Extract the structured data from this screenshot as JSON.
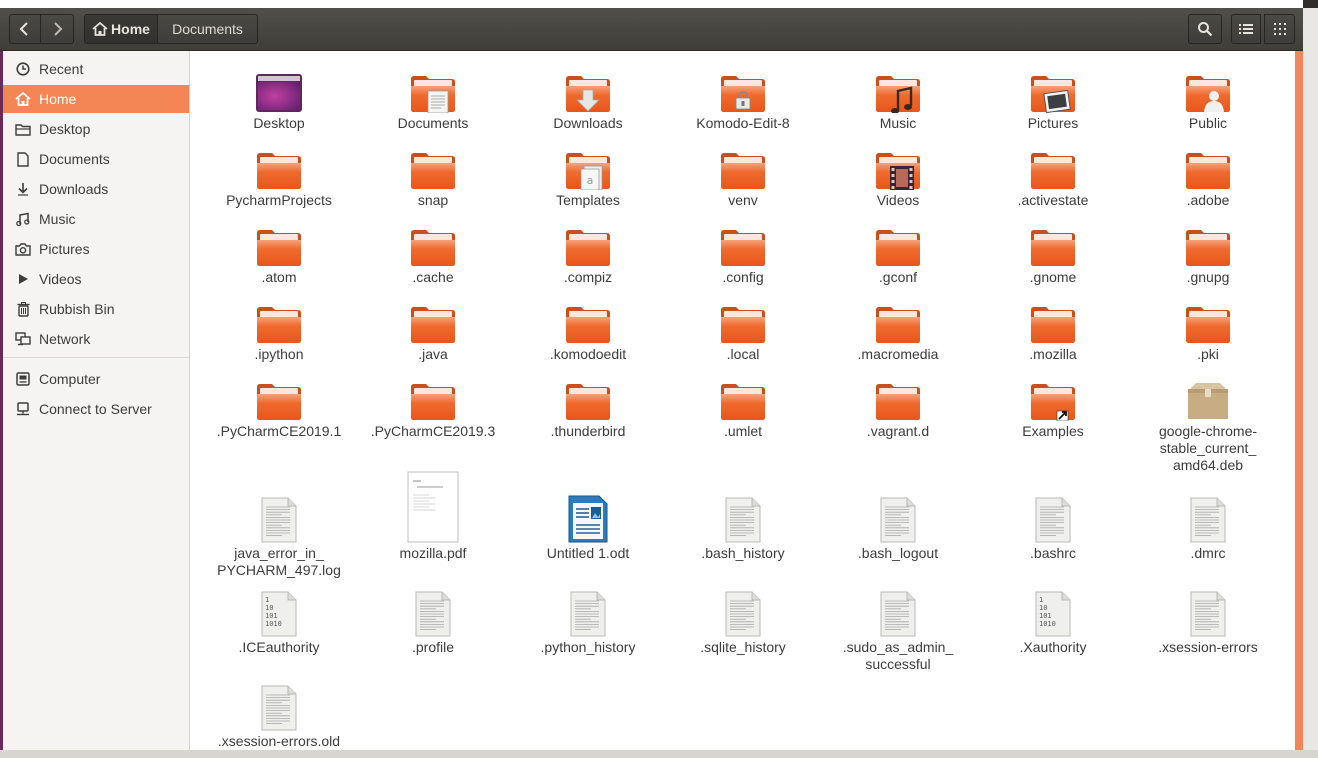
{
  "header": {
    "breadcrumb": {
      "home": "Home",
      "current": "Documents"
    }
  },
  "sidebar": {
    "items": [
      {
        "label": "Recent",
        "icon": "clock-icon"
      },
      {
        "label": "Home",
        "icon": "home-icon",
        "active": true
      },
      {
        "label": "Desktop",
        "icon": "folder-icon"
      },
      {
        "label": "Documents",
        "icon": "document-icon"
      },
      {
        "label": "Downloads",
        "icon": "download-icon"
      },
      {
        "label": "Music",
        "icon": "music-icon"
      },
      {
        "label": "Pictures",
        "icon": "camera-icon"
      },
      {
        "label": "Videos",
        "icon": "video-icon"
      },
      {
        "label": "Rubbish Bin",
        "icon": "trash-icon"
      },
      {
        "label": "Network",
        "icon": "network-icon"
      }
    ],
    "devices": [
      {
        "label": "Computer",
        "icon": "computer-icon"
      },
      {
        "label": "Connect to Server",
        "icon": "server-icon"
      }
    ]
  },
  "files": [
    {
      "name": "Desktop",
      "type": "desktop"
    },
    {
      "name": "Documents",
      "type": "folder-documents"
    },
    {
      "name": "Downloads",
      "type": "folder-downloads"
    },
    {
      "name": "Komodo-Edit-8",
      "type": "folder-locked"
    },
    {
      "name": "Music",
      "type": "folder-music"
    },
    {
      "name": "Pictures",
      "type": "folder-pictures"
    },
    {
      "name": "Public",
      "type": "folder-public"
    },
    {
      "name": "PycharmProjects",
      "type": "folder"
    },
    {
      "name": "snap",
      "type": "folder"
    },
    {
      "name": "Templates",
      "type": "folder-templates"
    },
    {
      "name": "venv",
      "type": "folder"
    },
    {
      "name": "Videos",
      "type": "folder-videos"
    },
    {
      "name": ".activestate",
      "type": "folder"
    },
    {
      "name": ".adobe",
      "type": "folder"
    },
    {
      "name": ".atom",
      "type": "folder"
    },
    {
      "name": ".cache",
      "type": "folder"
    },
    {
      "name": ".compiz",
      "type": "folder"
    },
    {
      "name": ".config",
      "type": "folder"
    },
    {
      "name": ".gconf",
      "type": "folder"
    },
    {
      "name": ".gnome",
      "type": "folder"
    },
    {
      "name": ".gnupg",
      "type": "folder"
    },
    {
      "name": ".ipython",
      "type": "folder"
    },
    {
      "name": ".java",
      "type": "folder"
    },
    {
      "name": ".komodoedit",
      "type": "folder"
    },
    {
      "name": ".local",
      "type": "folder"
    },
    {
      "name": ".macromedia",
      "type": "folder"
    },
    {
      "name": ".mozilla",
      "type": "folder"
    },
    {
      "name": ".pki",
      "type": "folder"
    },
    {
      "name": ".PyCharmCE2019.1",
      "type": "folder"
    },
    {
      "name": ".PyCharmCE2019.3",
      "type": "folder"
    },
    {
      "name": ".thunderbird",
      "type": "folder"
    },
    {
      "name": ".umlet",
      "type": "folder"
    },
    {
      "name": ".vagrant.d",
      "type": "folder"
    },
    {
      "name": "Examples",
      "type": "folder-link"
    },
    {
      "name": "google-chrome-stable_current_amd64.deb",
      "type": "package"
    },
    {
      "name": "java_error_in_PYCHARM_497.log",
      "type": "text"
    },
    {
      "name": "mozilla.pdf",
      "type": "pdf"
    },
    {
      "name": "Untitled 1.odt",
      "type": "odt"
    },
    {
      "name": ".bash_history",
      "type": "text"
    },
    {
      "name": ".bash_logout",
      "type": "text"
    },
    {
      "name": ".bashrc",
      "type": "text"
    },
    {
      "name": ".dmrc",
      "type": "text"
    },
    {
      "name": ".ICEauthority",
      "type": "binary"
    },
    {
      "name": ".profile",
      "type": "text"
    },
    {
      "name": ".python_history",
      "type": "text"
    },
    {
      "name": ".sqlite_history",
      "type": "text"
    },
    {
      "name": ".sudo_as_admin_successful",
      "type": "text"
    },
    {
      "name": ".Xauthority",
      "type": "binary"
    },
    {
      "name": ".xsession-errors",
      "type": "text"
    },
    {
      "name": ".xsession-errors.old",
      "type": "text"
    }
  ],
  "binary_glyph_text": [
    "1",
    "10",
    "101",
    "1010"
  ],
  "colors": {
    "folder_top": "#f6a27a",
    "folder_body": "#ef6a2e",
    "accent": "#f38654"
  }
}
